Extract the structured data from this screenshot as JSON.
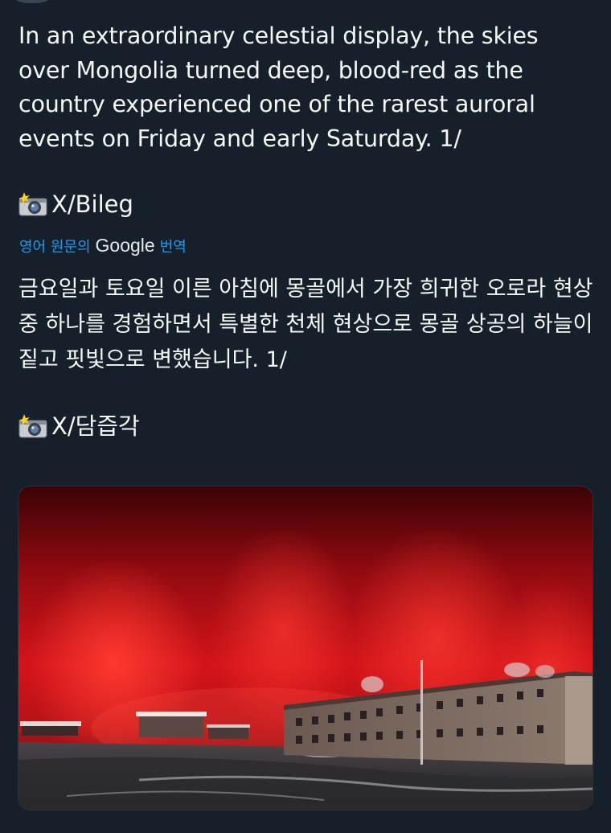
{
  "tweet": {
    "text": "In an extraordinary celestial display, the skies over Mongolia turned deep, blood-red as the country experienced one of the rarest auroral events on Friday and early Saturday. 1/",
    "credit_1": "X/Bileg",
    "translation_label": {
      "prefix": "영어 원문의",
      "brand": "Google",
      "suffix": "번역"
    },
    "translated_text": "금요일과 토요일 이른 아침에 몽골에서 가장 희귀한 오로라 현상 중 하나를 경험하면서 특별한 천체 현상으로 몽골 상공의 하늘이 짙고 핏빛으로 변했습니다. 1/",
    "credit_2": "X/담즙각",
    "camera_icon": "camera-with-flash-icon",
    "media": {
      "description_icon": "red-aurora-photo",
      "sky_color": "#d4141a",
      "ground_color": "#2a2a2e"
    }
  }
}
